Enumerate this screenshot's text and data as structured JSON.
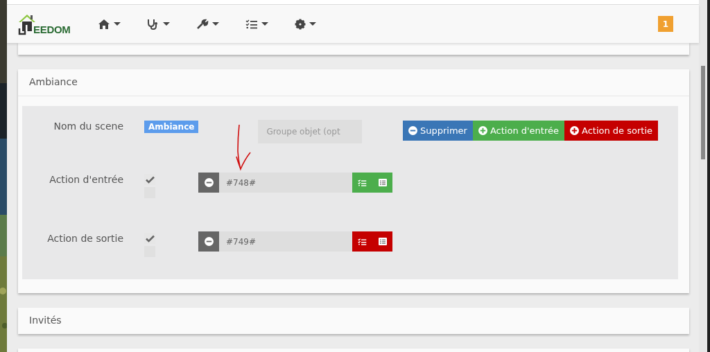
{
  "navbar": {
    "logo": "EEDOM",
    "menus": [
      {
        "kind": "home"
      },
      {
        "kind": "stethoscope"
      },
      {
        "kind": "wrench"
      },
      {
        "kind": "tasks"
      },
      {
        "kind": "gear"
      }
    ],
    "badge": "1"
  },
  "scene_panel": {
    "title": "Ambiance",
    "name_label": "Nom du scene",
    "name_tag": "Ambiance",
    "group_placeholder": "Groupe objet (opt",
    "buttons": [
      {
        "label": "Supprimer",
        "kind": "remove"
      },
      {
        "label": "Action d'entrée",
        "kind": "add_in"
      },
      {
        "label": "Action de sortie",
        "kind": "add_out"
      }
    ],
    "actions": [
      {
        "label": "Action d'entrée",
        "checked": true,
        "second_checked": false,
        "value": "#748#",
        "kind": "in"
      },
      {
        "label": "Action de sortie",
        "checked": true,
        "second_checked": false,
        "value": "#749#",
        "kind": "out"
      }
    ]
  },
  "next_panel": {
    "title": "Invités"
  }
}
